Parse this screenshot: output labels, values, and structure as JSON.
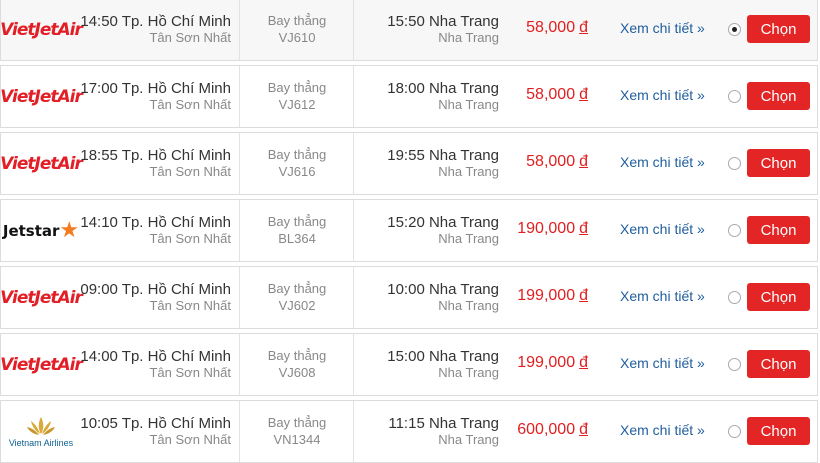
{
  "rows": [
    {
      "airline": "vietjet",
      "logo_text": "VietJetAir",
      "dep_time_city": "14:50 Tp. Hồ Chí Minh",
      "dep_airport": "Tân Sơn Nhất",
      "type": "Bay thẳng",
      "flight_no": "VJ610",
      "arr_time_city": "15:50 Nha Trang",
      "arr_airport": "Nha Trang",
      "price": "58,000",
      "currency": "đ",
      "detail": "Xem chi tiết »",
      "selected": true,
      "button": "Chọn"
    },
    {
      "airline": "vietjet",
      "logo_text": "VietJetAir",
      "dep_time_city": "17:00 Tp. Hồ Chí Minh",
      "dep_airport": "Tân Sơn Nhất",
      "type": "Bay thẳng",
      "flight_no": "VJ612",
      "arr_time_city": "18:00 Nha Trang",
      "arr_airport": "Nha Trang",
      "price": "58,000",
      "currency": "đ",
      "detail": "Xem chi tiết »",
      "selected": false,
      "button": "Chọn"
    },
    {
      "airline": "vietjet",
      "logo_text": "VietJetAir",
      "dep_time_city": "18:55 Tp. Hồ Chí Minh",
      "dep_airport": "Tân Sơn Nhất",
      "type": "Bay thẳng",
      "flight_no": "VJ616",
      "arr_time_city": "19:55 Nha Trang",
      "arr_airport": "Nha Trang",
      "price": "58,000",
      "currency": "đ",
      "detail": "Xem chi tiết »",
      "selected": false,
      "button": "Chọn"
    },
    {
      "airline": "jetstar",
      "logo_text": "Jetstar",
      "dep_time_city": "14:10 Tp. Hồ Chí Minh",
      "dep_airport": "Tân Sơn Nhất",
      "type": "Bay thẳng",
      "flight_no": "BL364",
      "arr_time_city": "15:20 Nha Trang",
      "arr_airport": "Nha Trang",
      "price": "190,000",
      "currency": "đ",
      "detail": "Xem chi tiết »",
      "selected": false,
      "button": "Chọn"
    },
    {
      "airline": "vietjet",
      "logo_text": "VietJetAir",
      "dep_time_city": "09:00 Tp. Hồ Chí Minh",
      "dep_airport": "Tân Sơn Nhất",
      "type": "Bay thẳng",
      "flight_no": "VJ602",
      "arr_time_city": "10:00 Nha Trang",
      "arr_airport": "Nha Trang",
      "price": "199,000",
      "currency": "đ",
      "detail": "Xem chi tiết »",
      "selected": false,
      "button": "Chọn"
    },
    {
      "airline": "vietjet",
      "logo_text": "VietJetAir",
      "dep_time_city": "14:00 Tp. Hồ Chí Minh",
      "dep_airport": "Tân Sơn Nhất",
      "type": "Bay thẳng",
      "flight_no": "VJ608",
      "arr_time_city": "15:00 Nha Trang",
      "arr_airport": "Nha Trang",
      "price": "199,000",
      "currency": "đ",
      "detail": "Xem chi tiết »",
      "selected": false,
      "button": "Chọn"
    },
    {
      "airline": "vietnam-airlines",
      "logo_text": "Vietnam Airlines",
      "dep_time_city": "10:05 Tp. Hồ Chí Minh",
      "dep_airport": "Tân Sơn Nhất",
      "type": "Bay thẳng",
      "flight_no": "VN1344",
      "arr_time_city": "11:15 Nha Trang",
      "arr_airport": "Nha Trang",
      "price": "600,000",
      "currency": "đ",
      "detail": "Xem chi tiết »",
      "selected": false,
      "button": "Chọn"
    }
  ],
  "colors": {
    "price": "#e02020",
    "button": "#e32526",
    "link": "#1f5e9e",
    "vietjet": "#e21e26",
    "jetstar_star": "#f47c20",
    "vna": "#0a5e8e"
  }
}
